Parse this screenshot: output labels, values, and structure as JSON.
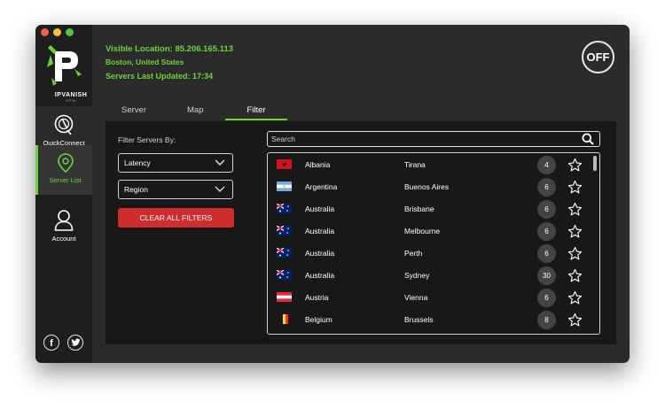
{
  "app": {
    "logo_text": "IPVANISH",
    "logo_sub": "VPN"
  },
  "sidebar": {
    "items": [
      {
        "label": "QuickConnect",
        "icon": "quickconnect-icon"
      },
      {
        "label": "Server List",
        "icon": "location-pin-icon"
      },
      {
        "label": "Account",
        "icon": "user-icon"
      }
    ],
    "social": [
      {
        "glyph": "f",
        "icon": "facebook-icon"
      },
      {
        "glyph": "t",
        "icon": "twitter-icon"
      }
    ]
  },
  "header": {
    "visible_location": "Visible Location: 85.206.165.113",
    "location_city": "Boston, United States",
    "servers_updated": "Servers Last Updated: 17:34",
    "off_label": "OFF"
  },
  "tabs": [
    "Server",
    "Map",
    "Filter"
  ],
  "filter": {
    "title": "Filter Servers By:",
    "latency_label": "Latency",
    "region_label": "Region",
    "clear_label": "CLEAR ALL FILTERS"
  },
  "search": {
    "placeholder": "Search",
    "value": ""
  },
  "servers": [
    {
      "country": "Albania",
      "city": "Tirana",
      "latency": "4",
      "flag": "albania"
    },
    {
      "country": "Argentina",
      "city": "Buenos Aires",
      "latency": "6",
      "flag": "argentina"
    },
    {
      "country": "Australia",
      "city": "Brisbane",
      "latency": "6",
      "flag": "australia"
    },
    {
      "country": "Australia",
      "city": "Melbourne",
      "latency": "6",
      "flag": "australia"
    },
    {
      "country": "Australia",
      "city": "Perth",
      "latency": "6",
      "flag": "australia"
    },
    {
      "country": "Australia",
      "city": "Sydney",
      "latency": "30",
      "flag": "australia"
    },
    {
      "country": "Austria",
      "city": "Vienna",
      "latency": "6",
      "flag": "austria"
    },
    {
      "country": "Belgium",
      "city": "Brussels",
      "latency": "8",
      "flag": "belgium"
    }
  ],
  "colors": {
    "accent": "#6fd23c",
    "danger": "#cf2d2d",
    "background": "#2b2b2b",
    "panel": "#181818"
  }
}
